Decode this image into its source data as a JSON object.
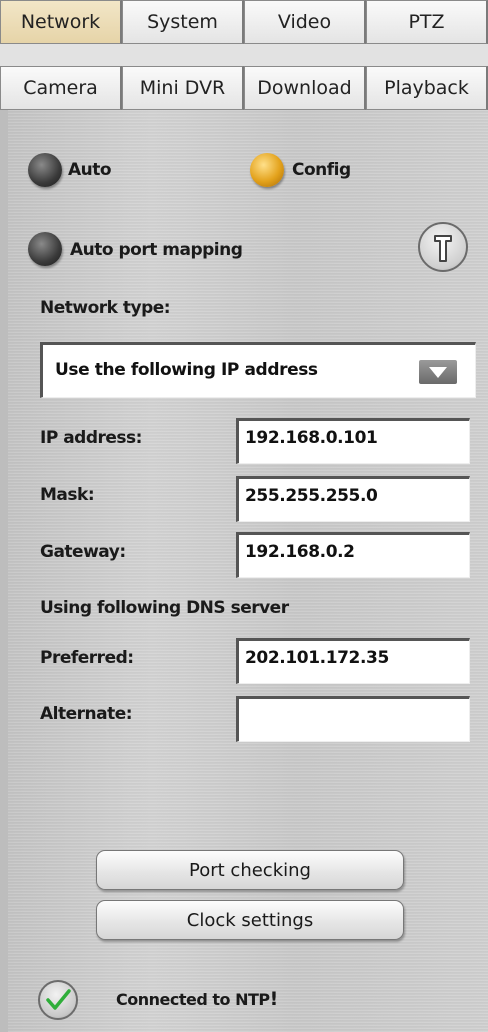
{
  "tabs_row1": [
    "Network",
    "System",
    "Video",
    "PTZ"
  ],
  "tabs_row2": [
    "Camera",
    "Mini DVR",
    "Download",
    "Playback"
  ],
  "active_tab": "Network",
  "mode": {
    "auto_label": "Auto",
    "config_label": "Config",
    "selected": "Config"
  },
  "auto_port_mapping_label": "Auto port mapping",
  "network_type": {
    "label": "Network type:",
    "selected": "Use the following IP address"
  },
  "ip_address": {
    "label": "IP address:",
    "value": "192.168.0.101"
  },
  "mask": {
    "label": "Mask:",
    "value": "255.255.255.0"
  },
  "gateway": {
    "label": "Gateway:",
    "value": "192.168.0.2"
  },
  "dns": {
    "heading": "Using following DNS server",
    "preferred_label": "Preferred:",
    "preferred_value": "202.101.172.35",
    "alternate_label": "Alternate:",
    "alternate_value": ""
  },
  "buttons": {
    "port_checking": "Port checking",
    "clock_settings": "Clock settings"
  },
  "status": {
    "text": "Connected to NTP",
    "mark": "!"
  },
  "colors": {
    "active_tab": "#efe2bf",
    "radio_on": "#e3a21c",
    "radio_off": "#3a3a3a",
    "check": "#2fae3a"
  },
  "icons": {
    "help": "help-icon",
    "dropdown": "chevron-down-icon",
    "status": "check-icon"
  }
}
